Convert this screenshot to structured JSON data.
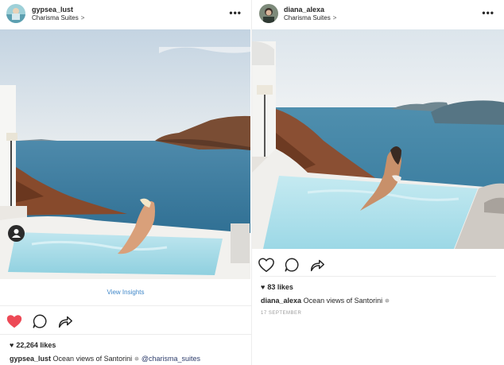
{
  "left_post": {
    "username": "gypsea_lust",
    "location": "Charisma Suites",
    "location_chevron": ">",
    "more": "•••",
    "view_insights": "View Insights",
    "likes_heart": "♥",
    "likes": "22,264 likes",
    "caption_user": "gypsea_lust",
    "caption_text": "Ocean views of Santorini",
    "caption_sparkle": "✵",
    "caption_mention": "@charisma_suites",
    "like_state": "liked",
    "icons": [
      "heart-icon",
      "comment-icon",
      "share-icon",
      "user-tag-icon"
    ],
    "accent": "#ed4956"
  },
  "right_post": {
    "username": "diana_alexa",
    "location": "Charisma Suites",
    "location_chevron": ">",
    "more": "•••",
    "likes_heart": "♥",
    "likes": "83 likes",
    "caption_user": "diana_alexa",
    "caption_text": "Ocean views of Santorini",
    "caption_sparkle": "✵",
    "date": "17 SEPTEMBER",
    "icons": [
      "heart-icon",
      "comment-icon",
      "share-icon"
    ]
  },
  "colors": {
    "link": "#3f87c9",
    "liked_heart": "#ed4956",
    "text": "#262626",
    "muted": "#999999",
    "sea": "#3f7fa0",
    "pool": "#a9dbe8"
  }
}
